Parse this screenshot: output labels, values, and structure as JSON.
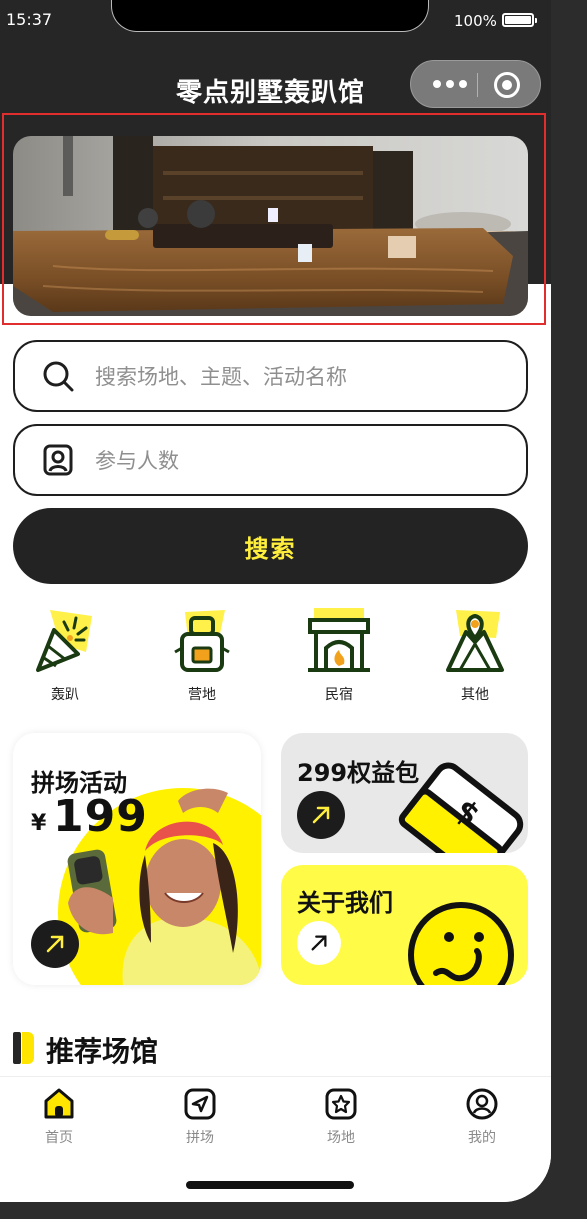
{
  "status_bar": {
    "time": "15:37",
    "battery": "100%"
  },
  "header": {
    "title": "零点别墅轰趴馆"
  },
  "search": {
    "keyword_placeholder": "搜索场地、主题、活动名称",
    "people_placeholder": "参与人数",
    "button_label": "搜索"
  },
  "categories": [
    {
      "label": "轰趴",
      "icon": "party-popper-icon"
    },
    {
      "label": "营地",
      "icon": "backpack-icon"
    },
    {
      "label": "民宿",
      "icon": "fireplace-icon"
    },
    {
      "label": "其他",
      "icon": "map-pin-icon"
    }
  ],
  "promo": {
    "group_title": "拼场活动",
    "group_currency": "¥",
    "group_price": "199",
    "benefit_title": "299权益包",
    "about_title": "关于我们"
  },
  "section": {
    "title": "推荐场馆"
  },
  "tabbar": [
    {
      "label": "首页",
      "icon": "home-icon"
    },
    {
      "label": "拼场",
      "icon": "send-icon"
    },
    {
      "label": "场地",
      "icon": "star-box-icon"
    },
    {
      "label": "我的",
      "icon": "user-icon"
    }
  ],
  "colors": {
    "accent": "#ffef3c",
    "dark": "#262626",
    "brand_yellow": "#ffe500"
  }
}
